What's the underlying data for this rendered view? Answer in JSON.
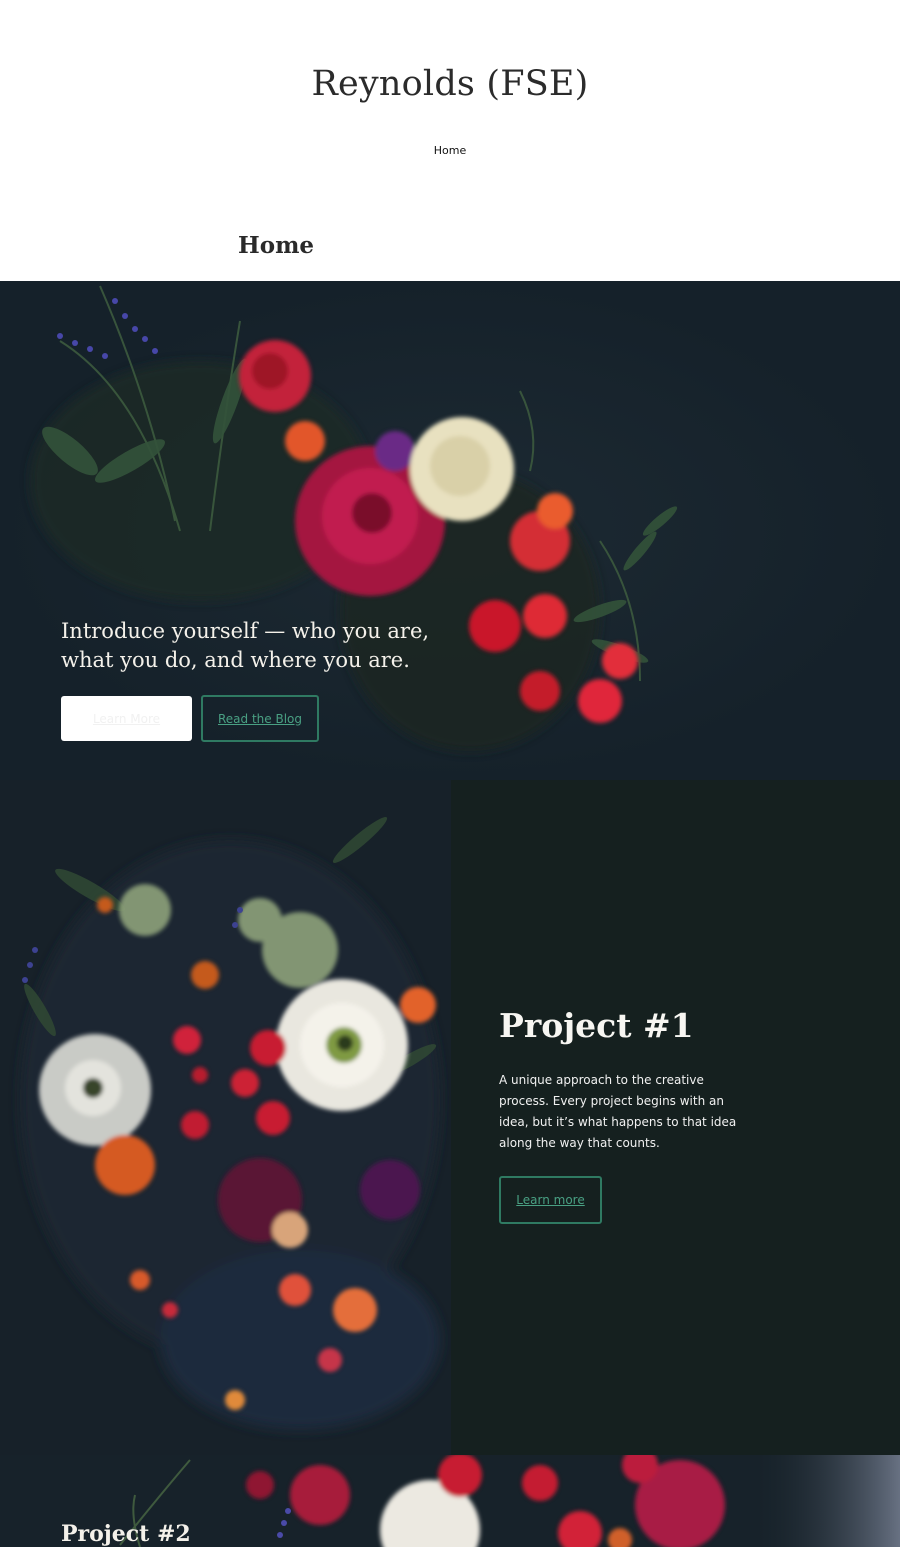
{
  "site": {
    "title": "Reynolds (FSE)",
    "nav": [
      {
        "label": "Home"
      }
    ]
  },
  "page": {
    "title": "Home"
  },
  "hero": {
    "text": "Introduce yourself — who you are, what you do, and where you are.",
    "primary_button": "Learn More",
    "secondary_button": "Read the Blog"
  },
  "project1": {
    "title": "Project #1",
    "description": "A unique approach to the creative process. Every project begins with an idea, but it’s what happens to that idea along the way that counts.",
    "button": "Learn more"
  },
  "project2": {
    "title": "Project #2"
  },
  "colors": {
    "hero_bg": "#15212a",
    "panel_bg": "#15201f",
    "accent": "#2f7a62",
    "accent_text": "#49a083"
  }
}
